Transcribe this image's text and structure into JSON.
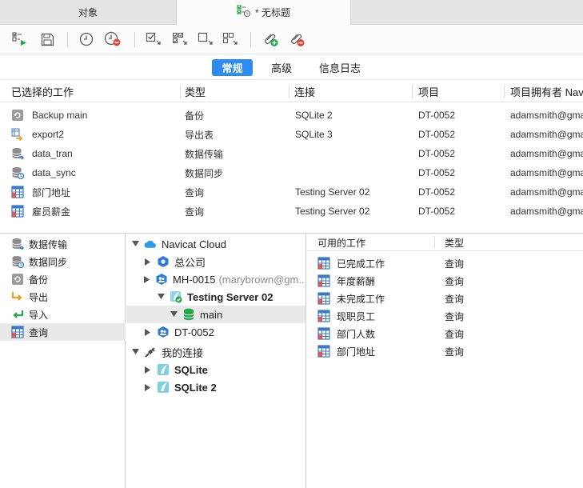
{
  "tabs": [
    {
      "label": "对象"
    },
    {
      "label": "* 无标题"
    }
  ],
  "toolbar": {
    "buttons": [
      "run-batch-icon",
      "save-icon",
      "set-schedule-icon",
      "delete-schedule-icon",
      "select-all-icon",
      "deselect-all-icon",
      "select-icon",
      "move-icon",
      "add-attachment-icon",
      "remove-attachment-icon"
    ]
  },
  "segments": {
    "general": "常规",
    "advanced": "高级",
    "log": "信息日志"
  },
  "jobs": {
    "headers": {
      "name": "已选择的工作",
      "type": "类型",
      "connection": "连接",
      "project": "项目",
      "owner": "项目拥有者 Nav"
    },
    "rows": [
      {
        "name": "Backup main",
        "type": "备份",
        "connection": "SQLite 2",
        "project": "DT-0052",
        "owner": "adamsmith@gma",
        "icon": "backup-icon"
      },
      {
        "name": "export2",
        "type": "导出表",
        "connection": "SQLite 3",
        "project": "DT-0052",
        "owner": "adamsmith@gma",
        "icon": "export-icon"
      },
      {
        "name": "data_tran",
        "type": "数据传输",
        "connection": "",
        "project": "DT-0052",
        "owner": "adamsmith@gma",
        "icon": "data-transfer-icon"
      },
      {
        "name": "data_sync",
        "type": "数据同步",
        "connection": "",
        "project": "DT-0052",
        "owner": "adamsmith@gma",
        "icon": "data-sync-icon"
      },
      {
        "name": "部门地址",
        "type": "查询",
        "connection": "Testing Server 02",
        "project": "DT-0052",
        "owner": "adamsmith@gma",
        "icon": "query-icon"
      },
      {
        "name": "雇员薪金",
        "type": "查询",
        "connection": "Testing Server 02",
        "project": "DT-0052",
        "owner": "adamsmith@gma",
        "icon": "query-icon"
      }
    ]
  },
  "categories": [
    {
      "label": "数据传输",
      "icon": "data-transfer-icon"
    },
    {
      "label": "数据同步",
      "icon": "data-sync-icon"
    },
    {
      "label": "备份",
      "icon": "backup-icon"
    },
    {
      "label": "导出",
      "icon": "export-icon"
    },
    {
      "label": "导入",
      "icon": "import-icon"
    },
    {
      "label": "查询",
      "icon": "query-icon"
    }
  ],
  "tree": {
    "navicat_cloud": "Navicat Cloud",
    "company": "总公司",
    "mh_project": "MH-0015",
    "mh_owner": "(marybrown@gm...",
    "server": "Testing Server 02",
    "database": "main",
    "dt_project": "DT-0052",
    "my_connections": "我的连接",
    "sqlite": "SQLite",
    "sqlite2": "SQLite 2"
  },
  "available": {
    "headers": {
      "name": "可用的工作",
      "type": "类型"
    },
    "rows": [
      {
        "name": "已完成工作",
        "type": "查询"
      },
      {
        "name": "年度薪酬",
        "type": "查询"
      },
      {
        "name": "未完成工作",
        "type": "查询"
      },
      {
        "name": "现职员工",
        "type": "查询"
      },
      {
        "name": "部门人数",
        "type": "查询"
      },
      {
        "name": "部门地址",
        "type": "查询"
      }
    ]
  },
  "colors": {
    "accent": "#2e8cf0",
    "query_grid": "#3a78c8",
    "green": "#22a94a",
    "orange": "#f0a020"
  }
}
